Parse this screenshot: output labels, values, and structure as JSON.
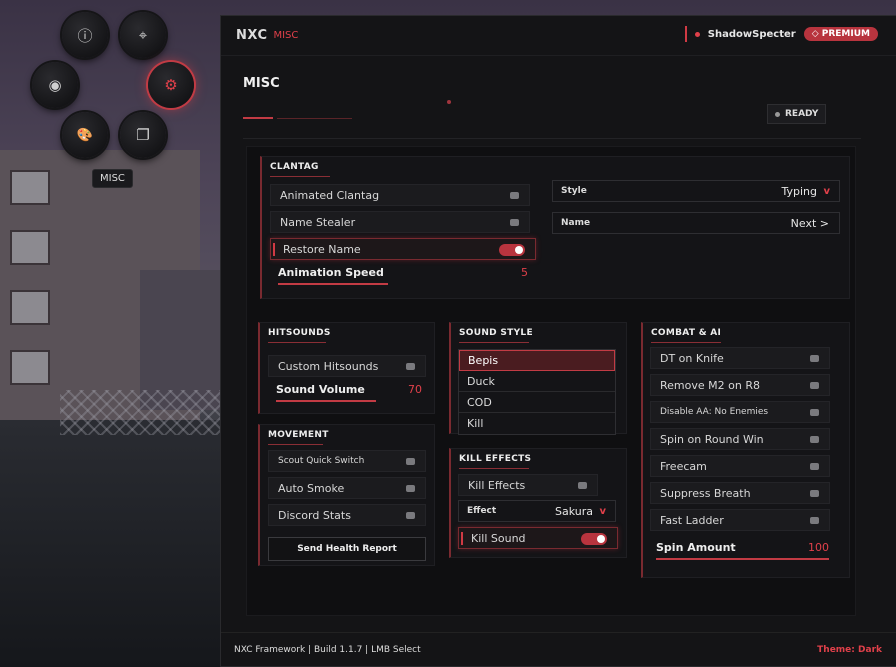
{
  "radial_menu": {
    "items": [
      {
        "icon": "info-icon",
        "glyph": "ⓘ"
      },
      {
        "icon": "crosshair-icon",
        "glyph": "⌖"
      },
      {
        "icon": "eye-icon",
        "glyph": "◉"
      },
      {
        "icon": "gear-icon",
        "glyph": "⚙"
      },
      {
        "icon": "palette-icon",
        "glyph": "🎨"
      },
      {
        "icon": "windows-icon",
        "glyph": "❐"
      }
    ],
    "tooltip": "MISC"
  },
  "titlebar": {
    "brand": "NXC",
    "section": "MISC",
    "username": "ShadowSpecter",
    "badge": "◇ PREMIUM"
  },
  "page": {
    "title": "MISC",
    "status": "READY"
  },
  "clantag": {
    "title": "CLANTAG",
    "toggles": [
      {
        "label": "Animated Clantag",
        "on": false
      },
      {
        "label": "Name Stealer",
        "on": false
      },
      {
        "label": "Restore Name",
        "on": true
      }
    ],
    "slider": {
      "label": "Animation Speed",
      "value": "5"
    },
    "style": {
      "label": "Style",
      "value": "Typing",
      "chevron": "v"
    },
    "name": {
      "label": "Name",
      "value": "Next >"
    }
  },
  "hitsounds": {
    "title": "HITSOUNDS",
    "toggles": [
      {
        "label": "Custom Hitsounds",
        "on": false
      }
    ],
    "slider": {
      "label": "Sound Volume",
      "value": "70"
    }
  },
  "movement": {
    "title": "MOVEMENT",
    "toggles": [
      {
        "label": "Scout Quick Switch",
        "on": false
      },
      {
        "label": "Auto Smoke",
        "on": false
      },
      {
        "label": "Discord Stats",
        "on": false
      }
    ],
    "button": "Send Health Report"
  },
  "sound_style": {
    "title": "SOUND STYLE",
    "options": [
      "Bepis",
      "Duck",
      "COD",
      "Kill"
    ],
    "selected": "Bepis"
  },
  "kill_effects": {
    "title": "KILL EFFECTS",
    "toggles": [
      {
        "label": "Kill Effects",
        "on": false
      },
      {
        "label": "Kill Sound",
        "on": true
      }
    ],
    "effect": {
      "label": "Effect",
      "value": "Sakura",
      "chevron": "v"
    }
  },
  "combat": {
    "title": "COMBAT & AI",
    "toggles": [
      {
        "label": "DT on Knife",
        "on": false
      },
      {
        "label": "Remove M2 on R8",
        "on": false
      },
      {
        "label": "Disable AA: No Enemies",
        "on": false
      },
      {
        "label": "Spin on Round Win",
        "on": false
      },
      {
        "label": "Freecam",
        "on": false
      },
      {
        "label": "Suppress Breath",
        "on": false
      },
      {
        "label": "Fast Ladder",
        "on": false
      }
    ],
    "slider": {
      "label": "Spin Amount",
      "value": "100"
    }
  },
  "footer": {
    "left": "NXC Framework | Build 1.1.7 | LMB Select",
    "right": "Theme: Dark"
  },
  "colors": {
    "accent": "#e0404a",
    "panel": "#141417",
    "window": "#141416"
  }
}
